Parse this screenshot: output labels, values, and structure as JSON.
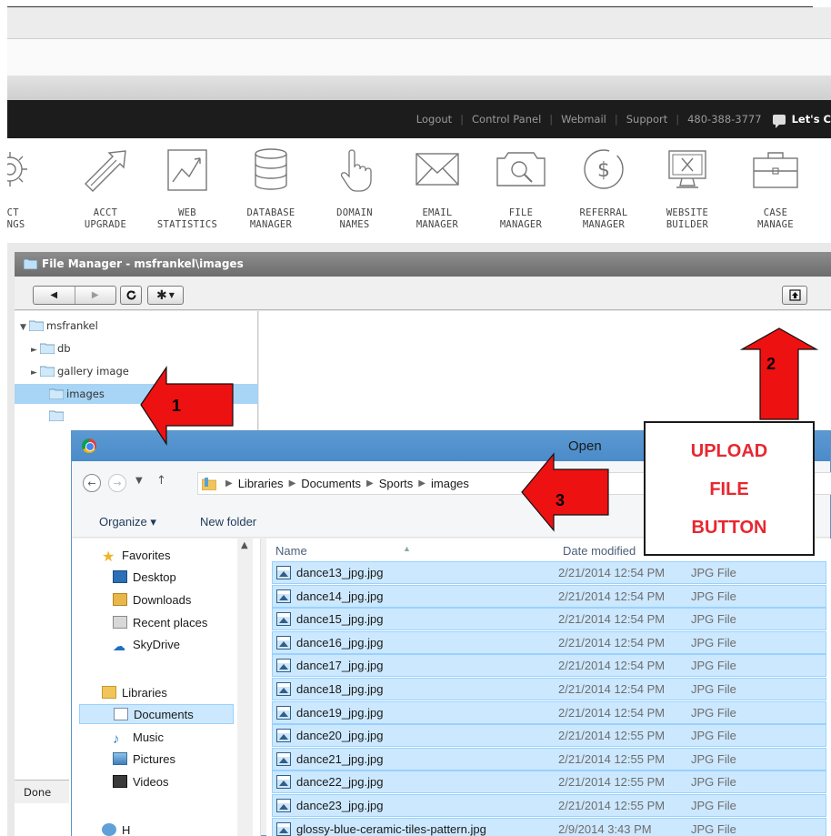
{
  "site": {
    "links": [
      "Logout",
      "Control Panel",
      "Webmail",
      "Support",
      "480-388-3777"
    ],
    "chat": "Let's C"
  },
  "tools": [
    {
      "icon": "gear-icon",
      "line1": "CCT",
      "line2": "TINGS"
    },
    {
      "icon": "upgrade-arrow-icon",
      "line1": "ACCT",
      "line2": "UPGRADE"
    },
    {
      "icon": "statistics-chart-icon",
      "line1": "WEB",
      "line2": "STATISTICS"
    },
    {
      "icon": "database-icon",
      "line1": "DATABASE",
      "line2": "MANAGER"
    },
    {
      "icon": "pointer-hand-icon",
      "line1": "DOMAIN",
      "line2": "NAMES"
    },
    {
      "icon": "envelope-icon",
      "line1": "EMAIL",
      "line2": "MANAGER"
    },
    {
      "icon": "folder-search-icon",
      "line1": "FILE",
      "line2": "MANAGER"
    },
    {
      "icon": "dollar-icon",
      "line1": "REFERRAL",
      "line2": "MANAGER"
    },
    {
      "icon": "website-builder-icon",
      "line1": "WEBSITE",
      "line2": "BUILDER"
    },
    {
      "icon": "briefcase-icon",
      "line1": "CASE",
      "line2": "MANAGE"
    }
  ],
  "file_manager": {
    "title": "File Manager - msfrankel\\images",
    "tree": [
      {
        "label": "msfrankel",
        "arrow": "▼"
      },
      {
        "label": "db",
        "arrow": "►"
      },
      {
        "label": "gallery image",
        "arrow": "►"
      },
      {
        "label": "images",
        "arrow": ""
      },
      {
        "label": "",
        "arrow": ""
      }
    ],
    "status": "Done"
  },
  "dialog": {
    "title": "Open",
    "breadcrumb": [
      "Libraries",
      "Documents",
      "Sports",
      "images"
    ],
    "organize": "Organize ▾",
    "new_folder": "New folder",
    "nav": {
      "favorites": "Favorites",
      "desktop": "Desktop",
      "downloads": "Downloads",
      "recent": "Recent places",
      "skydrive": "SkyDrive",
      "libraries": "Libraries",
      "documents": "Documents",
      "music": "Music",
      "pictures": "Pictures",
      "videos": "Videos",
      "homegroup": "H"
    },
    "columns": {
      "name": "Name",
      "date": "Date modified"
    },
    "files": [
      {
        "name": "dance13_jpg.jpg",
        "date": "2/21/2014 12:54 PM",
        "type": "JPG File"
      },
      {
        "name": "dance14_jpg.jpg",
        "date": "2/21/2014 12:54 PM",
        "type": "JPG File"
      },
      {
        "name": "dance15_jpg.jpg",
        "date": "2/21/2014 12:54 PM",
        "type": "JPG File"
      },
      {
        "name": "dance16_jpg.jpg",
        "date": "2/21/2014 12:54 PM",
        "type": "JPG File"
      },
      {
        "name": "dance17_jpg.jpg",
        "date": "2/21/2014 12:54 PM",
        "type": "JPG File"
      },
      {
        "name": "dance18_jpg.jpg",
        "date": "2/21/2014 12:54 PM",
        "type": "JPG File"
      },
      {
        "name": "dance19_jpg.jpg",
        "date": "2/21/2014 12:54 PM",
        "type": "JPG File"
      },
      {
        "name": "dance20_jpg.jpg",
        "date": "2/21/2014 12:55 PM",
        "type": "JPG File"
      },
      {
        "name": "dance21_jpg.jpg",
        "date": "2/21/2014 12:55 PM",
        "type": "JPG File"
      },
      {
        "name": "dance22_jpg.jpg",
        "date": "2/21/2014 12:55 PM",
        "type": "JPG File"
      },
      {
        "name": "dance23_jpg.jpg",
        "date": "2/21/2014 12:55 PM",
        "type": "JPG File"
      },
      {
        "name": "glossy-blue-ceramic-tiles-pattern.jpg",
        "date": "2/9/2014 3:43 PM",
        "type": "JPG File"
      }
    ]
  },
  "annotations": {
    "n1": "1",
    "n2": "2",
    "n3": "3",
    "callout": [
      "UPLOAD",
      "FILE",
      "BUTTON"
    ]
  },
  "colors": {
    "arrow_fill": "#ee1111",
    "callout_text": "#e8272f",
    "selection": "#cce8ff"
  }
}
